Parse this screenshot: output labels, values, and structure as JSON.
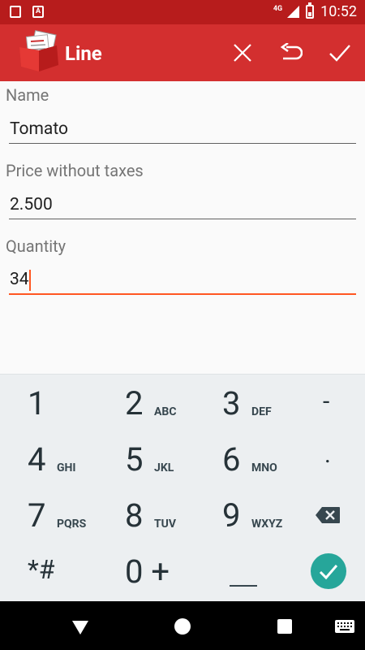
{
  "status_bar": {
    "network": "4G",
    "time": "10:52",
    "notification_icons": [
      "sd-card-icon",
      "font-icon"
    ]
  },
  "app_bar": {
    "title": "Line",
    "actions": [
      "close-icon",
      "undo-icon",
      "check-icon"
    ],
    "color": "#d32f2f"
  },
  "form": {
    "fields": [
      {
        "label": "Name",
        "value": "Tomato"
      },
      {
        "label": "Price without taxes",
        "value": "2.500"
      },
      {
        "label": "Quantity",
        "value": "34"
      }
    ],
    "accent_color": "#ff5722"
  },
  "keyboard": {
    "rows": [
      [
        {
          "num": "1",
          "sub": ""
        },
        {
          "num": "2",
          "sub": "ABC"
        },
        {
          "num": "3",
          "sub": "DEF"
        },
        {
          "num": "-",
          "sub": ""
        }
      ],
      [
        {
          "num": "4",
          "sub": "GHI"
        },
        {
          "num": "5",
          "sub": "JKL"
        },
        {
          "num": "6",
          "sub": "MNO"
        },
        {
          "num": ".",
          "sub": ""
        }
      ],
      [
        {
          "num": "7",
          "sub": "PQRS"
        },
        {
          "num": "8",
          "sub": "TUV"
        },
        {
          "num": "9",
          "sub": "WXYZ"
        },
        {
          "num": "",
          "sub": "backspace"
        }
      ],
      [
        {
          "num": "*#",
          "sub": ""
        },
        {
          "num": "0 +",
          "sub": ""
        },
        {
          "num": "_",
          "sub": "space"
        },
        {
          "num": "",
          "sub": "done"
        }
      ]
    ],
    "done_color": "#26a69a"
  },
  "nav_bar": {
    "buttons": [
      "back-icon",
      "home-icon",
      "recents-icon",
      "keyboard-icon"
    ]
  }
}
